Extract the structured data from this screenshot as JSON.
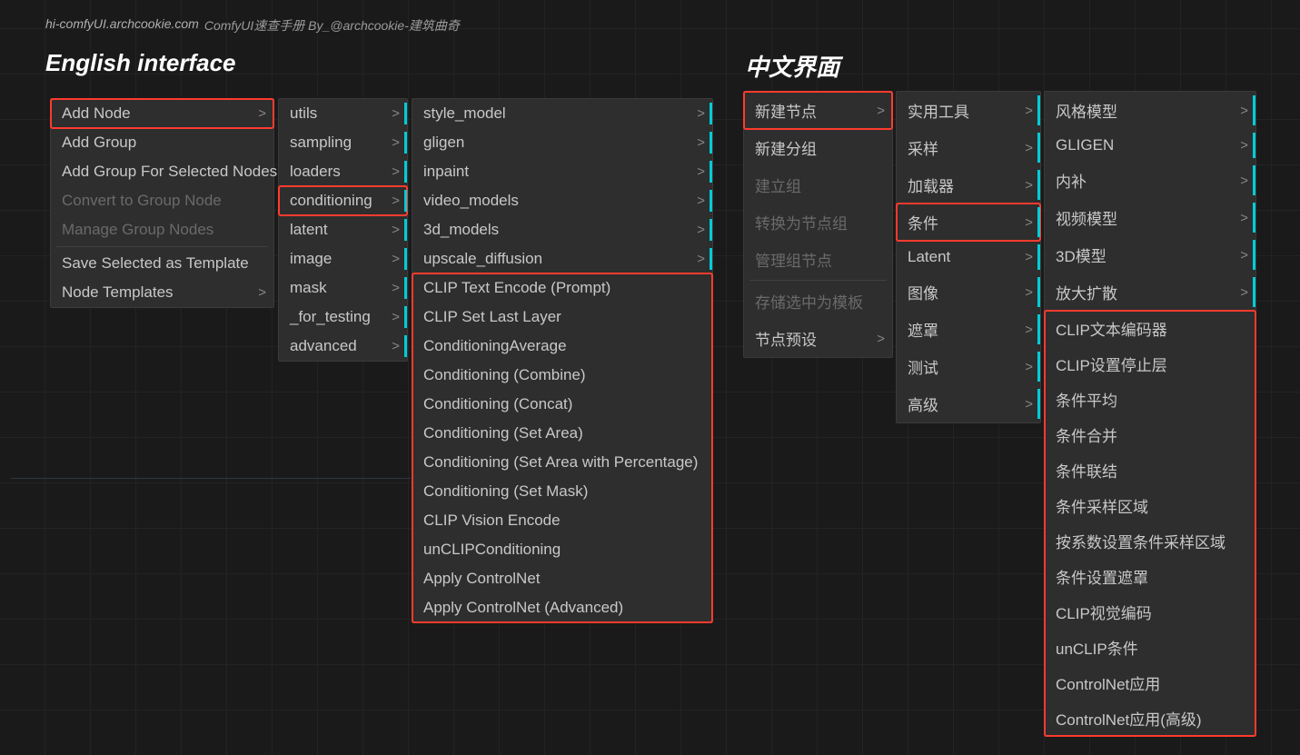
{
  "header": {
    "url": "hi-comfyUI.archcookie.com",
    "title": "ComfyUI速查手册  By_@archcookie-建筑曲奇"
  },
  "sections": {
    "english_title": "English interface",
    "chinese_title": "中文界面"
  },
  "english": {
    "col1": [
      {
        "label": "Add Node",
        "submenu": true,
        "highlighted": true
      },
      {
        "label": "Add Group"
      },
      {
        "label": "Add Group For Selected Nodes"
      },
      {
        "label": "Convert to Group Node",
        "disabled": true
      },
      {
        "label": "Manage Group Nodes",
        "disabled": true
      },
      {
        "sep": true
      },
      {
        "label": "Save Selected as Template"
      },
      {
        "label": "Node Templates",
        "submenu": true
      }
    ],
    "col2": [
      {
        "label": "utils",
        "submenu": true,
        "cyan": true
      },
      {
        "label": "sampling",
        "submenu": true,
        "cyan": true
      },
      {
        "label": "loaders",
        "submenu": true,
        "cyan": true
      },
      {
        "label": "conditioning",
        "submenu": true,
        "cyan": true,
        "highlighted": true
      },
      {
        "label": "latent",
        "submenu": true,
        "cyan": true
      },
      {
        "label": "image",
        "submenu": true,
        "cyan": true
      },
      {
        "label": "mask",
        "submenu": true,
        "cyan": true
      },
      {
        "label": "_for_testing",
        "submenu": true,
        "cyan": true
      },
      {
        "label": "advanced",
        "submenu": true,
        "cyan": true
      }
    ],
    "col3_top": [
      {
        "label": "style_model",
        "submenu": true,
        "cyan": true
      },
      {
        "label": "gligen",
        "submenu": true,
        "cyan": true
      },
      {
        "label": "inpaint",
        "submenu": true,
        "cyan": true
      },
      {
        "label": "video_models",
        "submenu": true,
        "cyan": true
      },
      {
        "label": "3d_models",
        "submenu": true,
        "cyan": true
      },
      {
        "label": "upscale_diffusion",
        "submenu": true,
        "cyan": true
      }
    ],
    "col3_sub": [
      {
        "label": "CLIP Text Encode (Prompt)"
      },
      {
        "label": "CLIP Set Last Layer"
      },
      {
        "label": "ConditioningAverage"
      },
      {
        "label": "Conditioning (Combine)"
      },
      {
        "label": "Conditioning (Concat)"
      },
      {
        "label": "Conditioning (Set Area)"
      },
      {
        "label": "Conditioning (Set Area with Percentage)"
      },
      {
        "label": "Conditioning (Set Mask)"
      },
      {
        "label": "CLIP Vision Encode"
      },
      {
        "label": "unCLIPConditioning"
      },
      {
        "label": "Apply ControlNet"
      },
      {
        "label": "Apply ControlNet (Advanced)"
      }
    ]
  },
  "chinese": {
    "col1": [
      {
        "label": "新建节点",
        "submenu": true,
        "highlighted": true
      },
      {
        "label": "新建分组"
      },
      {
        "label": "建立组",
        "disabled": true
      },
      {
        "label": "转换为节点组",
        "disabled": true
      },
      {
        "label": "管理组节点",
        "disabled": true
      },
      {
        "sep": true
      },
      {
        "label": "存储选中为模板",
        "disabled": true
      },
      {
        "label": "节点预设",
        "submenu": true
      }
    ],
    "col2": [
      {
        "label": "实用工具",
        "submenu": true,
        "cyan": true
      },
      {
        "label": "采样",
        "submenu": true,
        "cyan": true
      },
      {
        "label": "加载器",
        "submenu": true,
        "cyan": true
      },
      {
        "label": "条件",
        "submenu": true,
        "cyan": true,
        "highlighted": true
      },
      {
        "label": "Latent",
        "submenu": true,
        "cyan": true
      },
      {
        "label": "图像",
        "submenu": true,
        "cyan": true
      },
      {
        "label": "遮罩",
        "submenu": true,
        "cyan": true
      },
      {
        "label": "测试",
        "submenu": true,
        "cyan": true
      },
      {
        "label": "高级",
        "submenu": true,
        "cyan": true
      }
    ],
    "col3_top": [
      {
        "label": "风格模型",
        "submenu": true,
        "cyan": true
      },
      {
        "label": "GLIGEN",
        "submenu": true,
        "cyan": true
      },
      {
        "label": "内补",
        "submenu": true,
        "cyan": true
      },
      {
        "label": "视频模型",
        "submenu": true,
        "cyan": true
      },
      {
        "label": "3D模型",
        "submenu": true,
        "cyan": true
      },
      {
        "label": "放大扩散",
        "submenu": true,
        "cyan": true
      }
    ],
    "col3_sub": [
      {
        "label": "CLIP文本编码器"
      },
      {
        "label": "CLIP设置停止层"
      },
      {
        "label": "条件平均"
      },
      {
        "label": "条件合并"
      },
      {
        "label": "条件联结"
      },
      {
        "label": "条件采样区域"
      },
      {
        "label": "按系数设置条件采样区域"
      },
      {
        "label": "条件设置遮罩"
      },
      {
        "label": "CLIP视觉编码"
      },
      {
        "label": "unCLIP条件"
      },
      {
        "label": "ControlNet应用"
      },
      {
        "label": "ControlNet应用(高级)"
      }
    ]
  }
}
